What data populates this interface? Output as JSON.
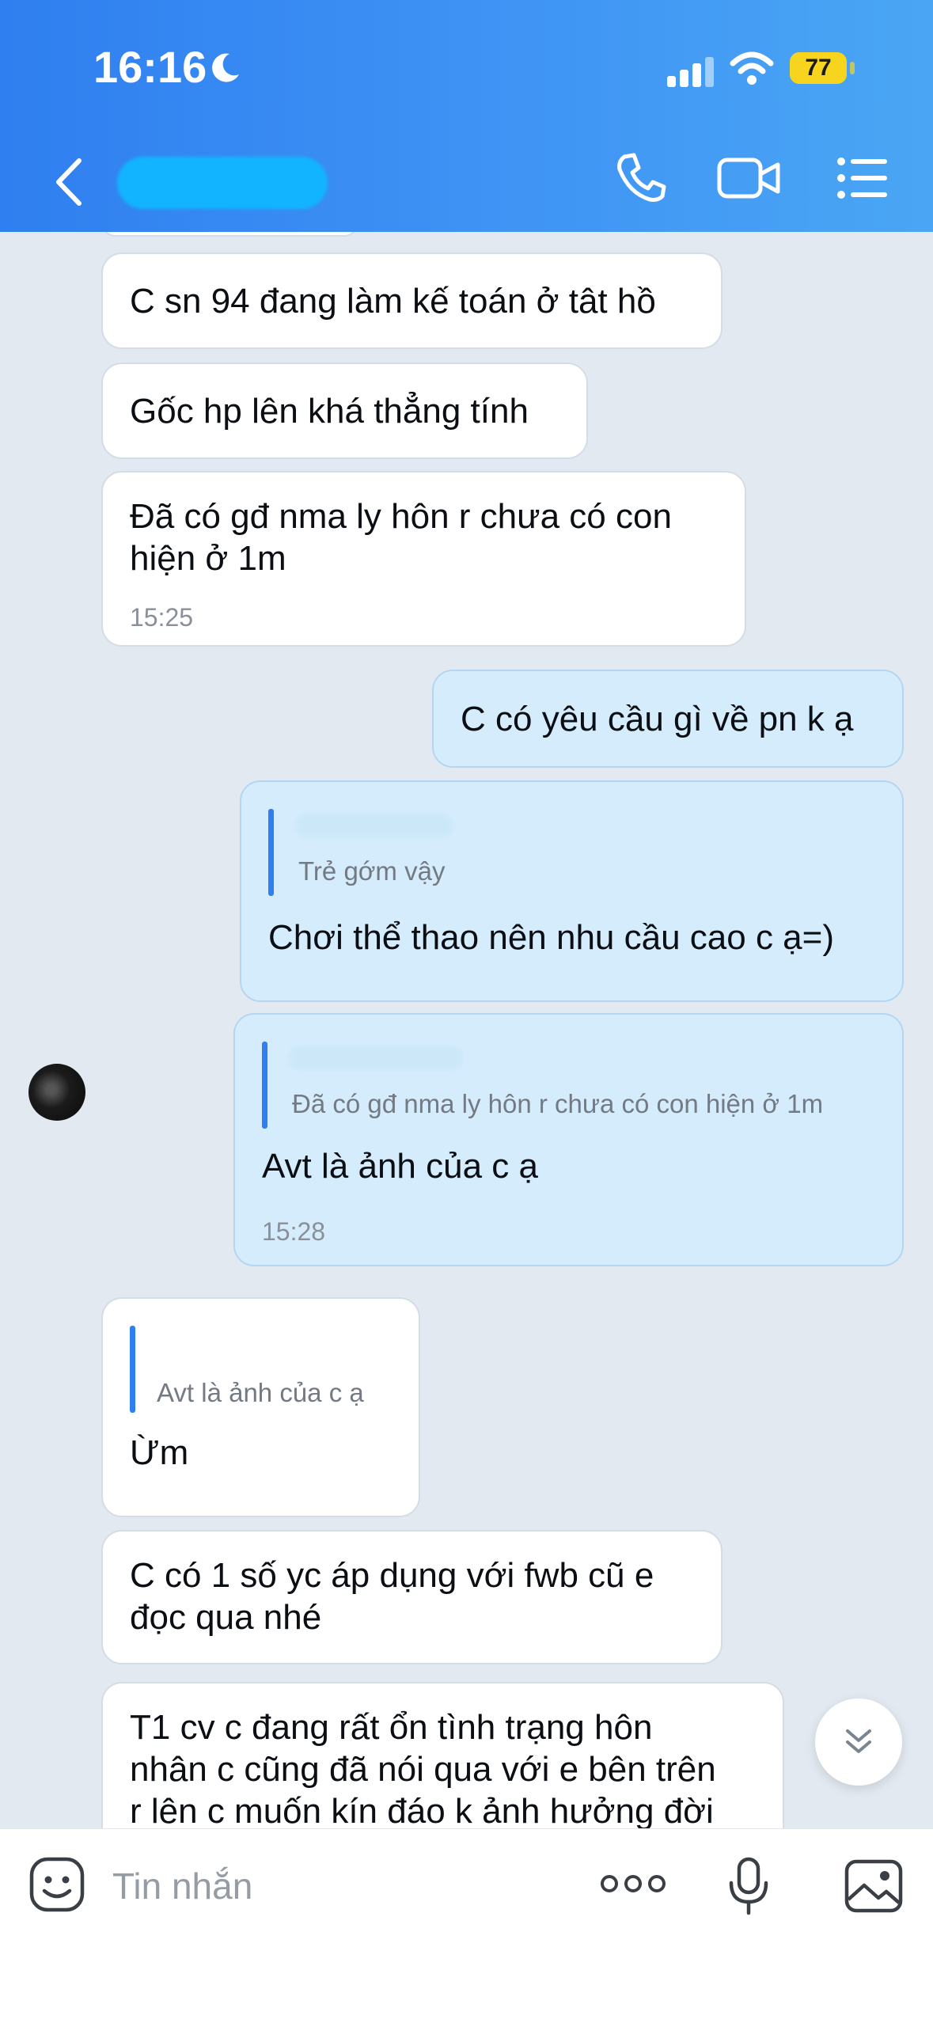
{
  "status_bar": {
    "time": "16:16",
    "battery": "77",
    "icons": [
      "moon-icon",
      "signal-icon",
      "wifi-icon",
      "battery-icon"
    ]
  },
  "header": {
    "back_icon": "chevron-left-icon",
    "icons": [
      "phone-icon",
      "video-camera-icon",
      "list-menu-icon"
    ],
    "color_start": "#2f7ff0",
    "color_end": "#4aa6f4"
  },
  "messages": [
    {
      "dir": "in",
      "text": "C sn 94 đang làm kế toán ở tât hồ"
    },
    {
      "dir": "in",
      "text": "Gốc hp lên khá thẳng tính"
    },
    {
      "dir": "in",
      "lines": [
        "Đã có gđ nma ly hôn r chưa có con",
        "hiện ở 1m"
      ],
      "time": "15:25"
    },
    {
      "dir": "out",
      "text": "C có yêu cầu gì về pn k ạ"
    },
    {
      "dir": "out",
      "quote": "Trẻ gớm vậy",
      "text": "Chơi thể thao nên nhu cầu cao c ạ=)"
    },
    {
      "dir": "out",
      "quote": "Đã có gđ nma ly hôn r chưa có con hiện ở 1m",
      "text": "Avt là ảnh của c ạ",
      "time": "15:28"
    },
    {
      "dir": "in",
      "quote": "Avt là ảnh của c ạ",
      "text": "Ừm"
    },
    {
      "dir": "in",
      "lines": [
        "C có 1 số yc áp dụng với fwb cũ e",
        "đọc qua nhé"
      ]
    },
    {
      "dir": "in",
      "lines": [
        "T1 cv c đang rất ổn tình trạng hôn",
        "nhân c cũng đã nói qua với e bên trên",
        "r lên c muốn kín đáo k ảnh hưởng đời"
      ]
    }
  ],
  "input": {
    "placeholder": "Tin nhắn",
    "value": ""
  },
  "colors": {
    "incoming_bubble": "#ffffff",
    "outgoing_bubble": "#d5ecfd",
    "chat_background": "#e2e9f1",
    "quote_bar": "#2f7ff0"
  }
}
